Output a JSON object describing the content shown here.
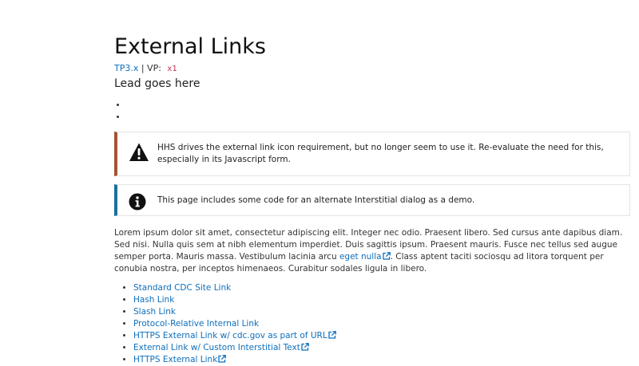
{
  "header": {
    "title": "External Links",
    "tp_link": "TP3.x",
    "separator": " | VP: ",
    "vp_code": "x1",
    "lead": "Lead goes here"
  },
  "callouts": {
    "warning_text": "HHS drives the external link icon requirement, but no longer seem to use it. Re-evaluate the need for this, especially in its Javascript form.",
    "info_text": "This page includes some code for an alternate Interstitial dialog as a demo."
  },
  "body": {
    "text_before_link": "Lorem ipsum dolor sit amet, consectetur adipiscing elit. Integer nec odio. Praesent libero. Sed cursus ante dapibus diam. Sed nisi. Nulla quis sem at nibh elementum imperdiet. Duis sagittis ipsum. Praesent mauris. Fusce nec tellus sed augue semper porta. Mauris massa. Vestibulum lacinia arcu ",
    "link_text": "eget nulla",
    "text_after_link": ". Class aptent taciti sociosqu ad litora torquent per conubia nostra, per inceptos himenaeos. Curabitur sodales ligula in libero."
  },
  "links": [
    {
      "label": "Standard CDC Site Link"
    },
    {
      "label": "Hash Link"
    },
    {
      "label": "Slash Link"
    },
    {
      "label": "Protocol-Relative Internal Link"
    },
    {
      "label": "HTTPS External Link w/ cdc.gov as part of URL"
    },
    {
      "label": "External Link w/ Custom Interstitial Text"
    },
    {
      "label": "HTTPS External Link"
    }
  ],
  "colors": {
    "link": "#0e6fbc",
    "warning_border": "#a25434",
    "info_border": "#1b6f9e"
  },
  "icons": {
    "warning": "warning-triangle-icon",
    "info": "info-circle-icon",
    "external": "external-link-icon"
  }
}
